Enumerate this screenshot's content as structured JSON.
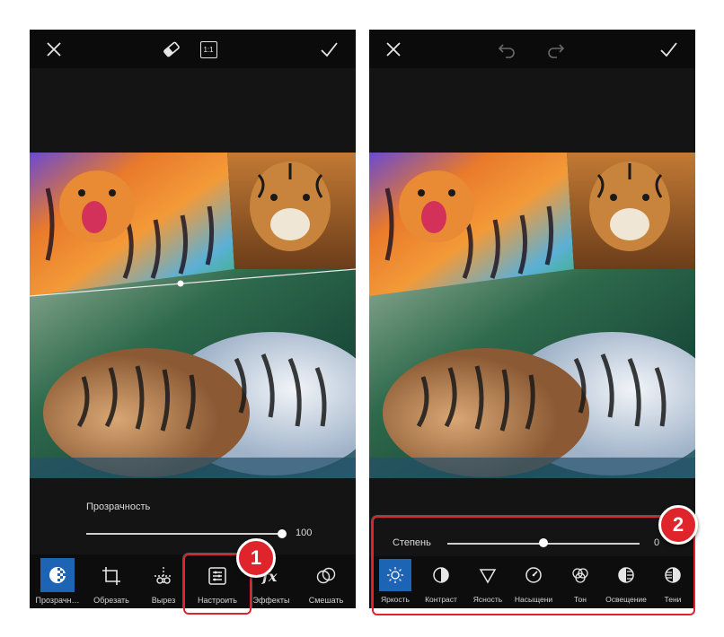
{
  "left_screen": {
    "topbar": {
      "close_icon": "x-icon",
      "eraser_icon": "eraser-icon",
      "ratio_label": "1:1",
      "apply_icon": "checkmark-icon"
    },
    "opacity": {
      "label": "Прозрачность",
      "value": "100",
      "level_percent": 100
    },
    "toolbar": [
      {
        "label": "Прозрачн…",
        "icon": "transparency-icon",
        "active": true
      },
      {
        "label": "Обрезать",
        "icon": "crop-icon",
        "active": false
      },
      {
        "label": "Вырез",
        "icon": "cutout-icon",
        "active": false
      },
      {
        "label": "Настроить",
        "icon": "adjust-icon",
        "active": false
      },
      {
        "label": "Эффекты",
        "icon": "fx-icon",
        "active": false
      },
      {
        "label": "Смешать",
        "icon": "blend-icon",
        "active": false
      }
    ],
    "step_badge": "1"
  },
  "right_screen": {
    "topbar": {
      "close_icon": "x-icon",
      "undo_icon": "undo-icon",
      "redo_icon": "redo-icon",
      "apply_icon": "checkmark-icon"
    },
    "degree": {
      "label": "Степень",
      "value": "0",
      "level_percent": 50
    },
    "adjustments": [
      {
        "label": "Яркость",
        "icon": "brightness-icon",
        "active": true
      },
      {
        "label": "Контраст",
        "icon": "contrast-icon",
        "active": false
      },
      {
        "label": "Ясность",
        "icon": "clarity-icon",
        "active": false
      },
      {
        "label": "Насыщени",
        "icon": "saturation-icon",
        "active": false
      },
      {
        "label": "Тон",
        "icon": "hue-icon",
        "active": false
      },
      {
        "label": "Освещение",
        "icon": "highlights-icon",
        "active": false
      },
      {
        "label": "Тени",
        "icon": "shadows-icon",
        "active": false
      }
    ],
    "step_badge": "2"
  },
  "colors": {
    "accent_blue": "#1e64b4",
    "callout_red": "#e0242c"
  }
}
